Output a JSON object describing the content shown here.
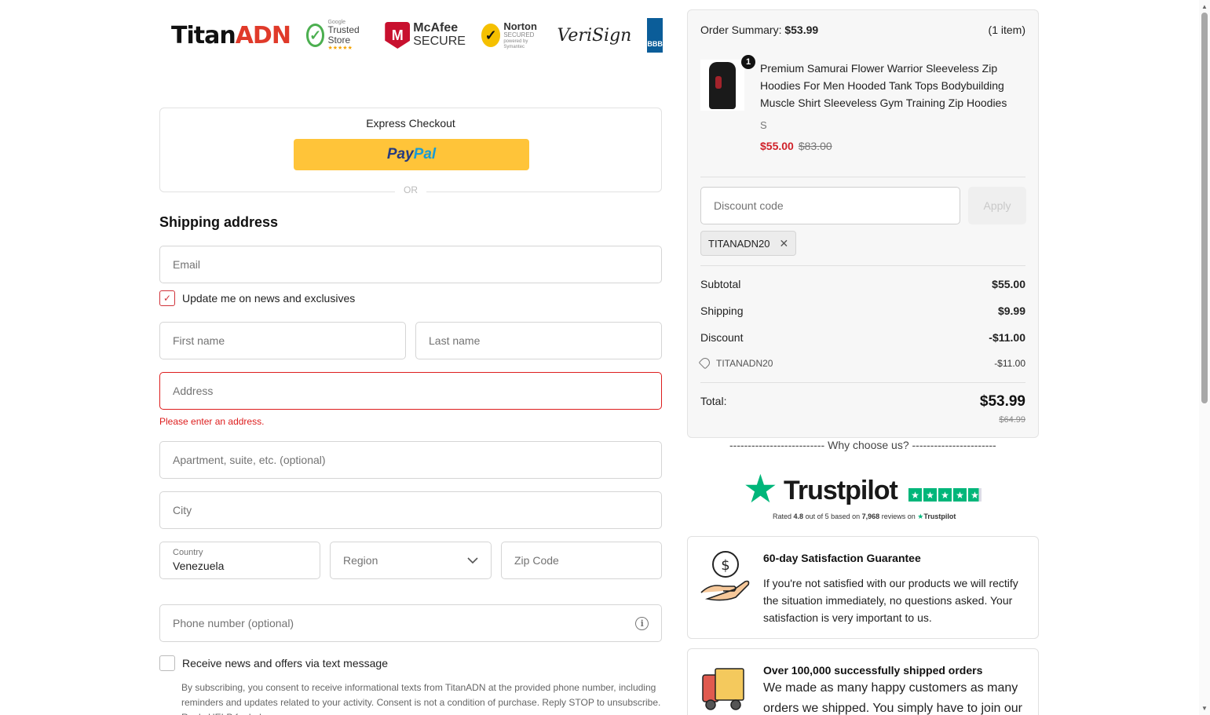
{
  "logos": {
    "brand_main": "Titan",
    "brand_accent": "ADN",
    "trusted_store_small": "Google",
    "trusted_store": "Trusted Store",
    "trusted_store_stars": "★★★★★",
    "mcafee_line1": "McAfee",
    "mcafee_line2": "SECURE",
    "norton_line1": "Norton",
    "norton_line2": "SECURED",
    "norton_small": "powered by Symantec",
    "verisign": "VeriSign",
    "bbb": "BBB"
  },
  "express": {
    "title": "Express Checkout",
    "paypal_pay": "Pay",
    "paypal_pal": "Pal",
    "or": "OR"
  },
  "shipping": {
    "heading": "Shipping address",
    "email_placeholder": "Email",
    "news_label": "Update me on news and exclusives",
    "first_name_placeholder": "First name",
    "last_name_placeholder": "Last name",
    "address_placeholder": "Address",
    "address_error": "Please enter an address.",
    "apartment_placeholder": "Apartment, suite, etc. (optional)",
    "city_placeholder": "City",
    "country_label": "Country",
    "country_value": "Venezuela",
    "region_placeholder": "Region",
    "zip_placeholder": "Zip Code",
    "phone_placeholder": "Phone number (optional)",
    "sms_label": "Receive news and offers via text message",
    "consent_text": "By subscribing, you consent to receive informational texts from TitanADN at the provided phone number, including reminders and updates related to your activity. Consent is not a condition of purchase. Reply STOP to unsubscribe. Reply HELP for help."
  },
  "summary": {
    "title_label": "Order Summary:",
    "title_amount": "$53.99",
    "item_count": "(1 item)",
    "product": {
      "quantity": "1",
      "name": "Premium Samurai Flower Warrior Sleeveless Zip Hoodies For Men Hooded Tank Tops Bodybuilding Muscle Shirt Sleeveless Gym Training Zip Hoodies",
      "variant": "S",
      "price": "$55.00",
      "compare_price": "$83.00"
    },
    "discount_placeholder": "Discount code",
    "apply_label": "Apply",
    "applied_code": "TITANADN20",
    "subtotal_label": "Subtotal",
    "subtotal_value": "$55.00",
    "shipping_label": "Shipping",
    "shipping_value": "$9.99",
    "discount_label": "Discount",
    "discount_value": "-$11.00",
    "code_line_label": "TITANADN20",
    "code_line_value": "-$11.00",
    "total_label": "Total:",
    "total_value": "$53.99",
    "total_compare": "$64.99"
  },
  "why": {
    "heading": "-------------------------- Why choose us? --------------------------"
  },
  "trustpilot": {
    "word": "Trustpilot",
    "rated_prefix": "Rated",
    "rating": "4.8",
    "mid": "out of 5 based on",
    "reviews": "7,968",
    "suffix": "reviews on",
    "brand_small": "Trustpilot"
  },
  "cards": [
    {
      "title": "60-day Satisfaction Guarantee",
      "body": "If you're not satisfied with our products we will rectify the situation immediately, no questions asked. Your satisfaction is very important to us."
    },
    {
      "title": "Over 100,000 successfully shipped orders",
      "body": "We made as many happy customers as many orders we shipped. You simply have to join our big family."
    }
  ],
  "colors": {
    "accent_red": "#d0222a",
    "paypal_yellow": "#ffc439",
    "trustpilot_green": "#00b67a"
  }
}
